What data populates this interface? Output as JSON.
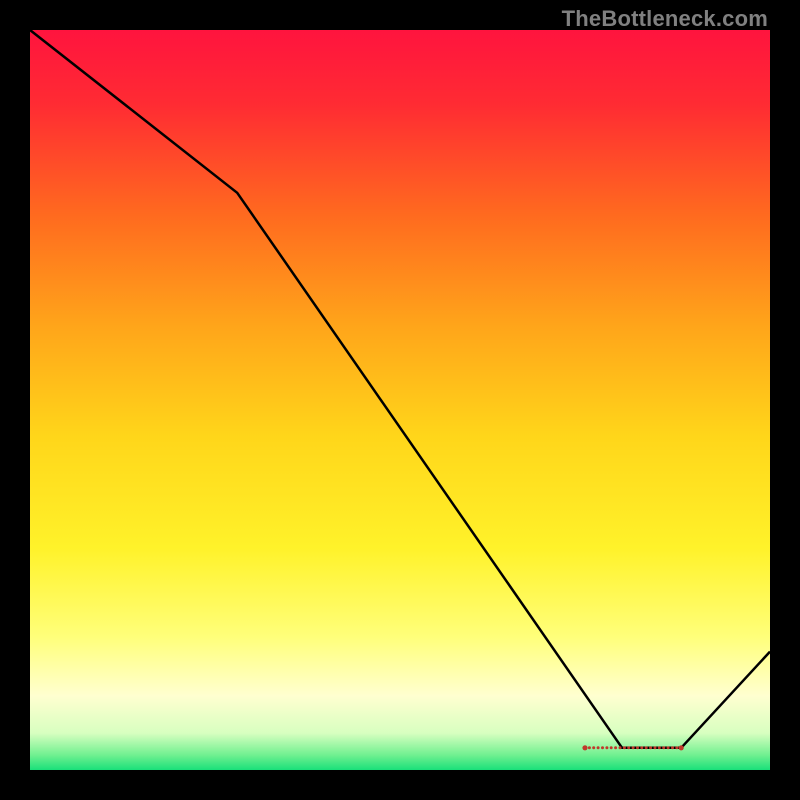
{
  "watermark": "TheBottleneck.com",
  "chart_data": {
    "type": "line",
    "title": "",
    "xlabel": "",
    "ylabel": "",
    "xlim": [
      0,
      100
    ],
    "ylim": [
      0,
      100
    ],
    "x": [
      0,
      28,
      80,
      88,
      100
    ],
    "y": [
      100,
      78,
      3,
      3,
      16
    ],
    "grid": false,
    "legend": false,
    "background_gradient": {
      "orientation": "vertical",
      "stops": [
        {
          "pos": 0.0,
          "color": "#ff143e"
        },
        {
          "pos": 0.1,
          "color": "#ff2b33"
        },
        {
          "pos": 0.25,
          "color": "#ff6a1f"
        },
        {
          "pos": 0.4,
          "color": "#ffa51a"
        },
        {
          "pos": 0.55,
          "color": "#ffd61a"
        },
        {
          "pos": 0.7,
          "color": "#fff22a"
        },
        {
          "pos": 0.82,
          "color": "#ffff7a"
        },
        {
          "pos": 0.9,
          "color": "#ffffd0"
        },
        {
          "pos": 0.95,
          "color": "#d8ffc0"
        },
        {
          "pos": 0.98,
          "color": "#70f090"
        },
        {
          "pos": 1.0,
          "color": "#19e07a"
        }
      ]
    },
    "highlight_strip": {
      "y": 3,
      "x_start": 75,
      "x_end": 88,
      "color": "#c0392b"
    }
  }
}
